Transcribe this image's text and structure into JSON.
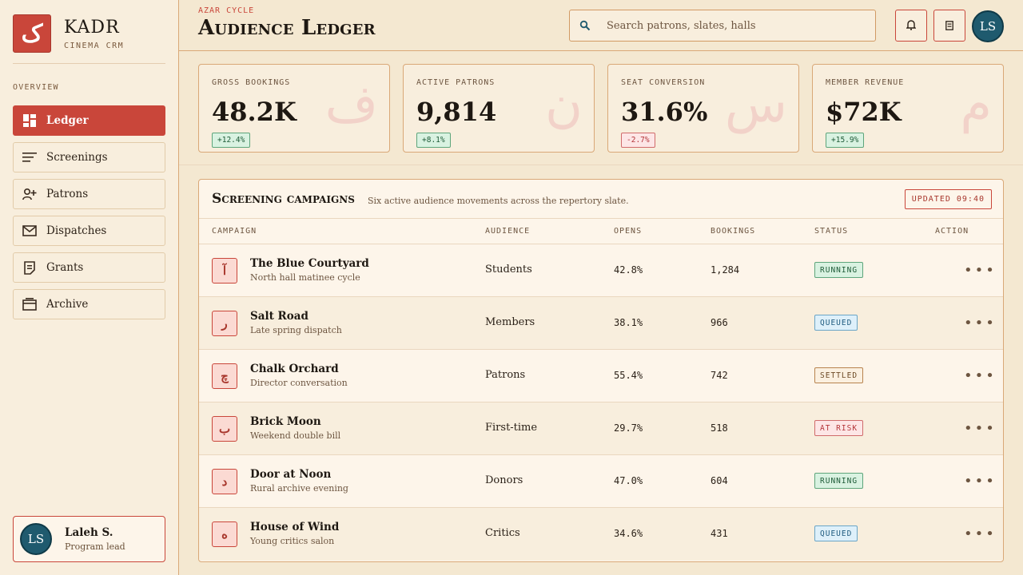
{
  "brand": {
    "logo_glyph": "ک",
    "name": "KADR",
    "subtitle": "CINEMA CRM"
  },
  "sidebar": {
    "section": "OVERVIEW",
    "items": [
      {
        "label": "Ledger",
        "icon": "grid-icon",
        "active": true
      },
      {
        "label": "Screenings",
        "icon": "lines-icon"
      },
      {
        "label": "Patrons",
        "icon": "user-plus-icon"
      },
      {
        "label": "Dispatches",
        "icon": "mail-icon"
      },
      {
        "label": "Grants",
        "icon": "document-icon"
      },
      {
        "label": "Archive",
        "icon": "archive-icon"
      }
    ],
    "user": {
      "initials": "LS",
      "name": "Laleh S.",
      "role": "Program lead"
    }
  },
  "header": {
    "eyebrow": "AZAR CYCLE",
    "title": "Audience Ledger",
    "search_placeholder": "Search patrons, slates, halls",
    "avatar_initials": "LS"
  },
  "stats": [
    {
      "label": "GROSS BOOKINGS",
      "value": "48.2K",
      "delta": "+12.4%",
      "glyph": "ف",
      "trend": "up"
    },
    {
      "label": "ACTIVE PATRONS",
      "value": "9,814",
      "delta": "+8.1%",
      "glyph": "ن",
      "trend": "up"
    },
    {
      "label": "SEAT CONVERSION",
      "value": "31.6%",
      "delta": "-2.7%",
      "glyph": "س",
      "trend": "down"
    },
    {
      "label": "MEMBER REVENUE",
      "value": "$72K",
      "delta": "+15.9%",
      "glyph": "م",
      "trend": "up"
    }
  ],
  "campaigns": {
    "title": "Screening campaigns",
    "subtitle": "Six active audience movements across the repertory slate.",
    "updated": "UPDATED 09:40",
    "columns": [
      "CAMPAIGN",
      "AUDIENCE",
      "OPENS",
      "BOOKINGS",
      "STATUS",
      "ACTION"
    ],
    "rows": [
      {
        "glyph": "آ",
        "name": "The Blue Courtyard",
        "desc": "North hall matinee cycle",
        "audience": "Students",
        "opens": "42.8%",
        "bookings": "1,284",
        "status": "RUNNING"
      },
      {
        "glyph": "ر",
        "name": "Salt Road",
        "desc": "Late spring dispatch",
        "audience": "Members",
        "opens": "38.1%",
        "bookings": "966",
        "status": "QUEUED"
      },
      {
        "glyph": "چ",
        "name": "Chalk Orchard",
        "desc": "Director conversation",
        "audience": "Patrons",
        "opens": "55.4%",
        "bookings": "742",
        "status": "SETTLED"
      },
      {
        "glyph": "ب",
        "name": "Brick Moon",
        "desc": "Weekend double bill",
        "audience": "First-time",
        "opens": "29.7%",
        "bookings": "518",
        "status": "AT RISK"
      },
      {
        "glyph": "د",
        "name": "Door at Noon",
        "desc": "Rural archive evening",
        "audience": "Donors",
        "opens": "47.0%",
        "bookings": "604",
        "status": "RUNNING"
      },
      {
        "glyph": "ه",
        "name": "House of Wind",
        "desc": "Young critics salon",
        "audience": "Critics",
        "opens": "34.6%",
        "bookings": "431",
        "status": "QUEUED"
      }
    ],
    "action_glyph": "•••"
  }
}
